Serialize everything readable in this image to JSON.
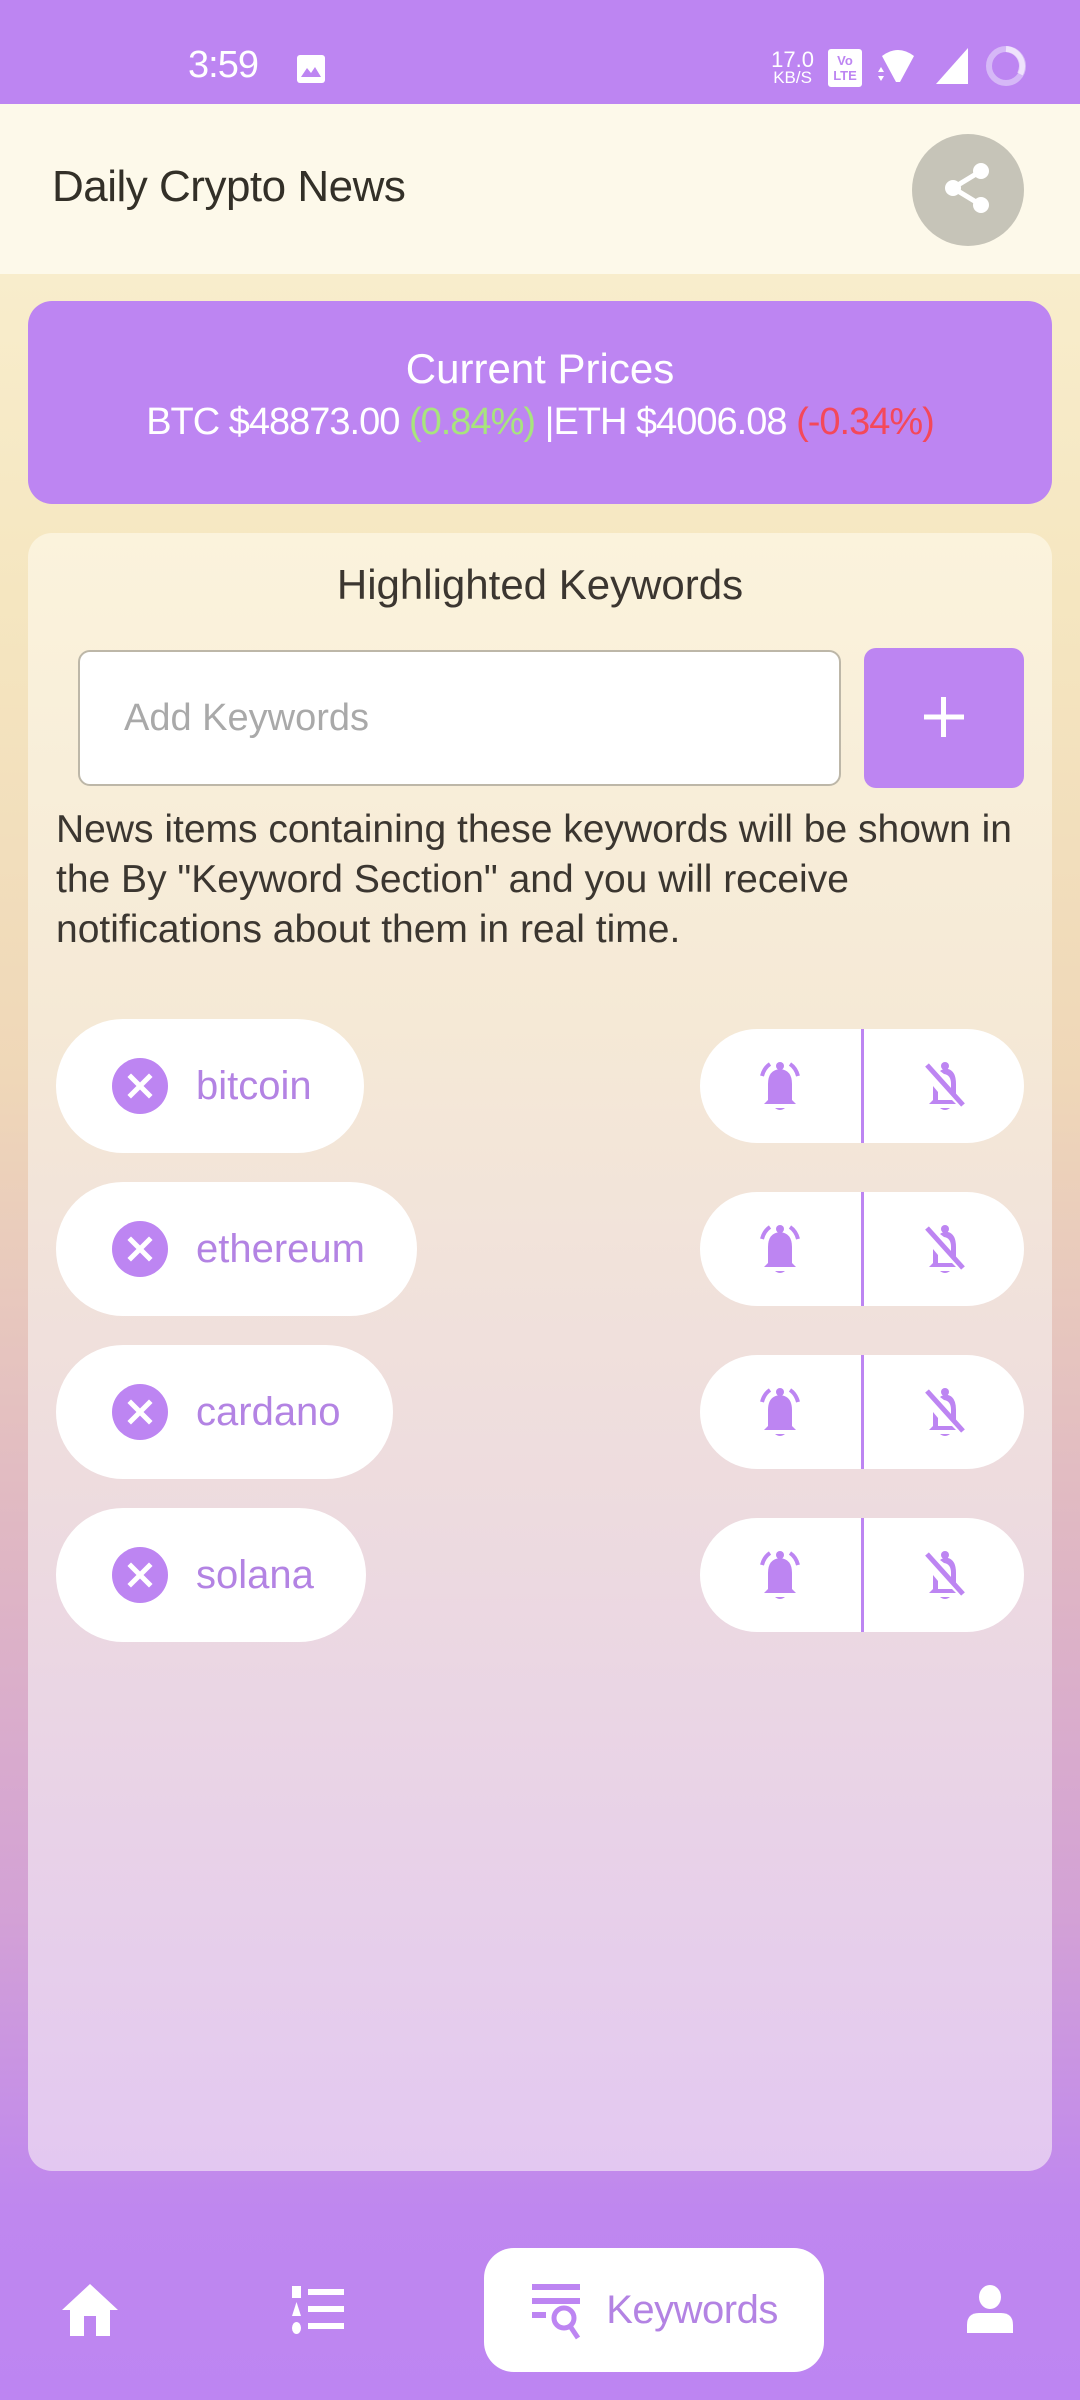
{
  "status_bar": {
    "time": "3:59",
    "net_speed_value": "17.0",
    "net_speed_unit": "KB/S",
    "volte_label": "Vo LTE",
    "icons": [
      "image-notification-icon",
      "volte-icon",
      "wifi-icon",
      "cell-signal-icon",
      "battery-ring-icon"
    ]
  },
  "header": {
    "title": "Daily Crypto News",
    "share_icon": "share-icon"
  },
  "prices": {
    "title": "Current Prices",
    "btc_symbol": "BTC",
    "btc_price": "$48873.00",
    "btc_change": "(0.84%)",
    "separator": "|",
    "eth_symbol": "ETH",
    "eth_price": "$4006.08",
    "eth_change": "(-0.34%)",
    "colors": {
      "positive": "#a8e47e",
      "negative": "#f4485a"
    }
  },
  "keywords": {
    "title": "Highlighted Keywords",
    "input_value": "",
    "input_placeholder": "Add Keywords",
    "add_button_icon": "plus-icon",
    "description": "News items containing these keywords will be shown in the By \"Keyword Section\" and you will receive notifications about them in real time.",
    "items": [
      {
        "label": "bitcoin"
      },
      {
        "label": "ethereum"
      },
      {
        "label": "cardano"
      },
      {
        "label": "solana"
      }
    ]
  },
  "bottom_nav": {
    "items": [
      {
        "name": "home",
        "icon": "home-icon",
        "label": ""
      },
      {
        "name": "list",
        "icon": "list-icon",
        "label": ""
      },
      {
        "name": "keywords",
        "icon": "keyword-search-icon",
        "label": "Keywords",
        "active": true
      },
      {
        "name": "profile",
        "icon": "person-icon",
        "label": ""
      }
    ]
  },
  "theme": {
    "accent": "#bd85f2",
    "header_bg": "#fdf9ea",
    "share_bg": "#c6c4b8",
    "chip_text": "#b383e3"
  }
}
